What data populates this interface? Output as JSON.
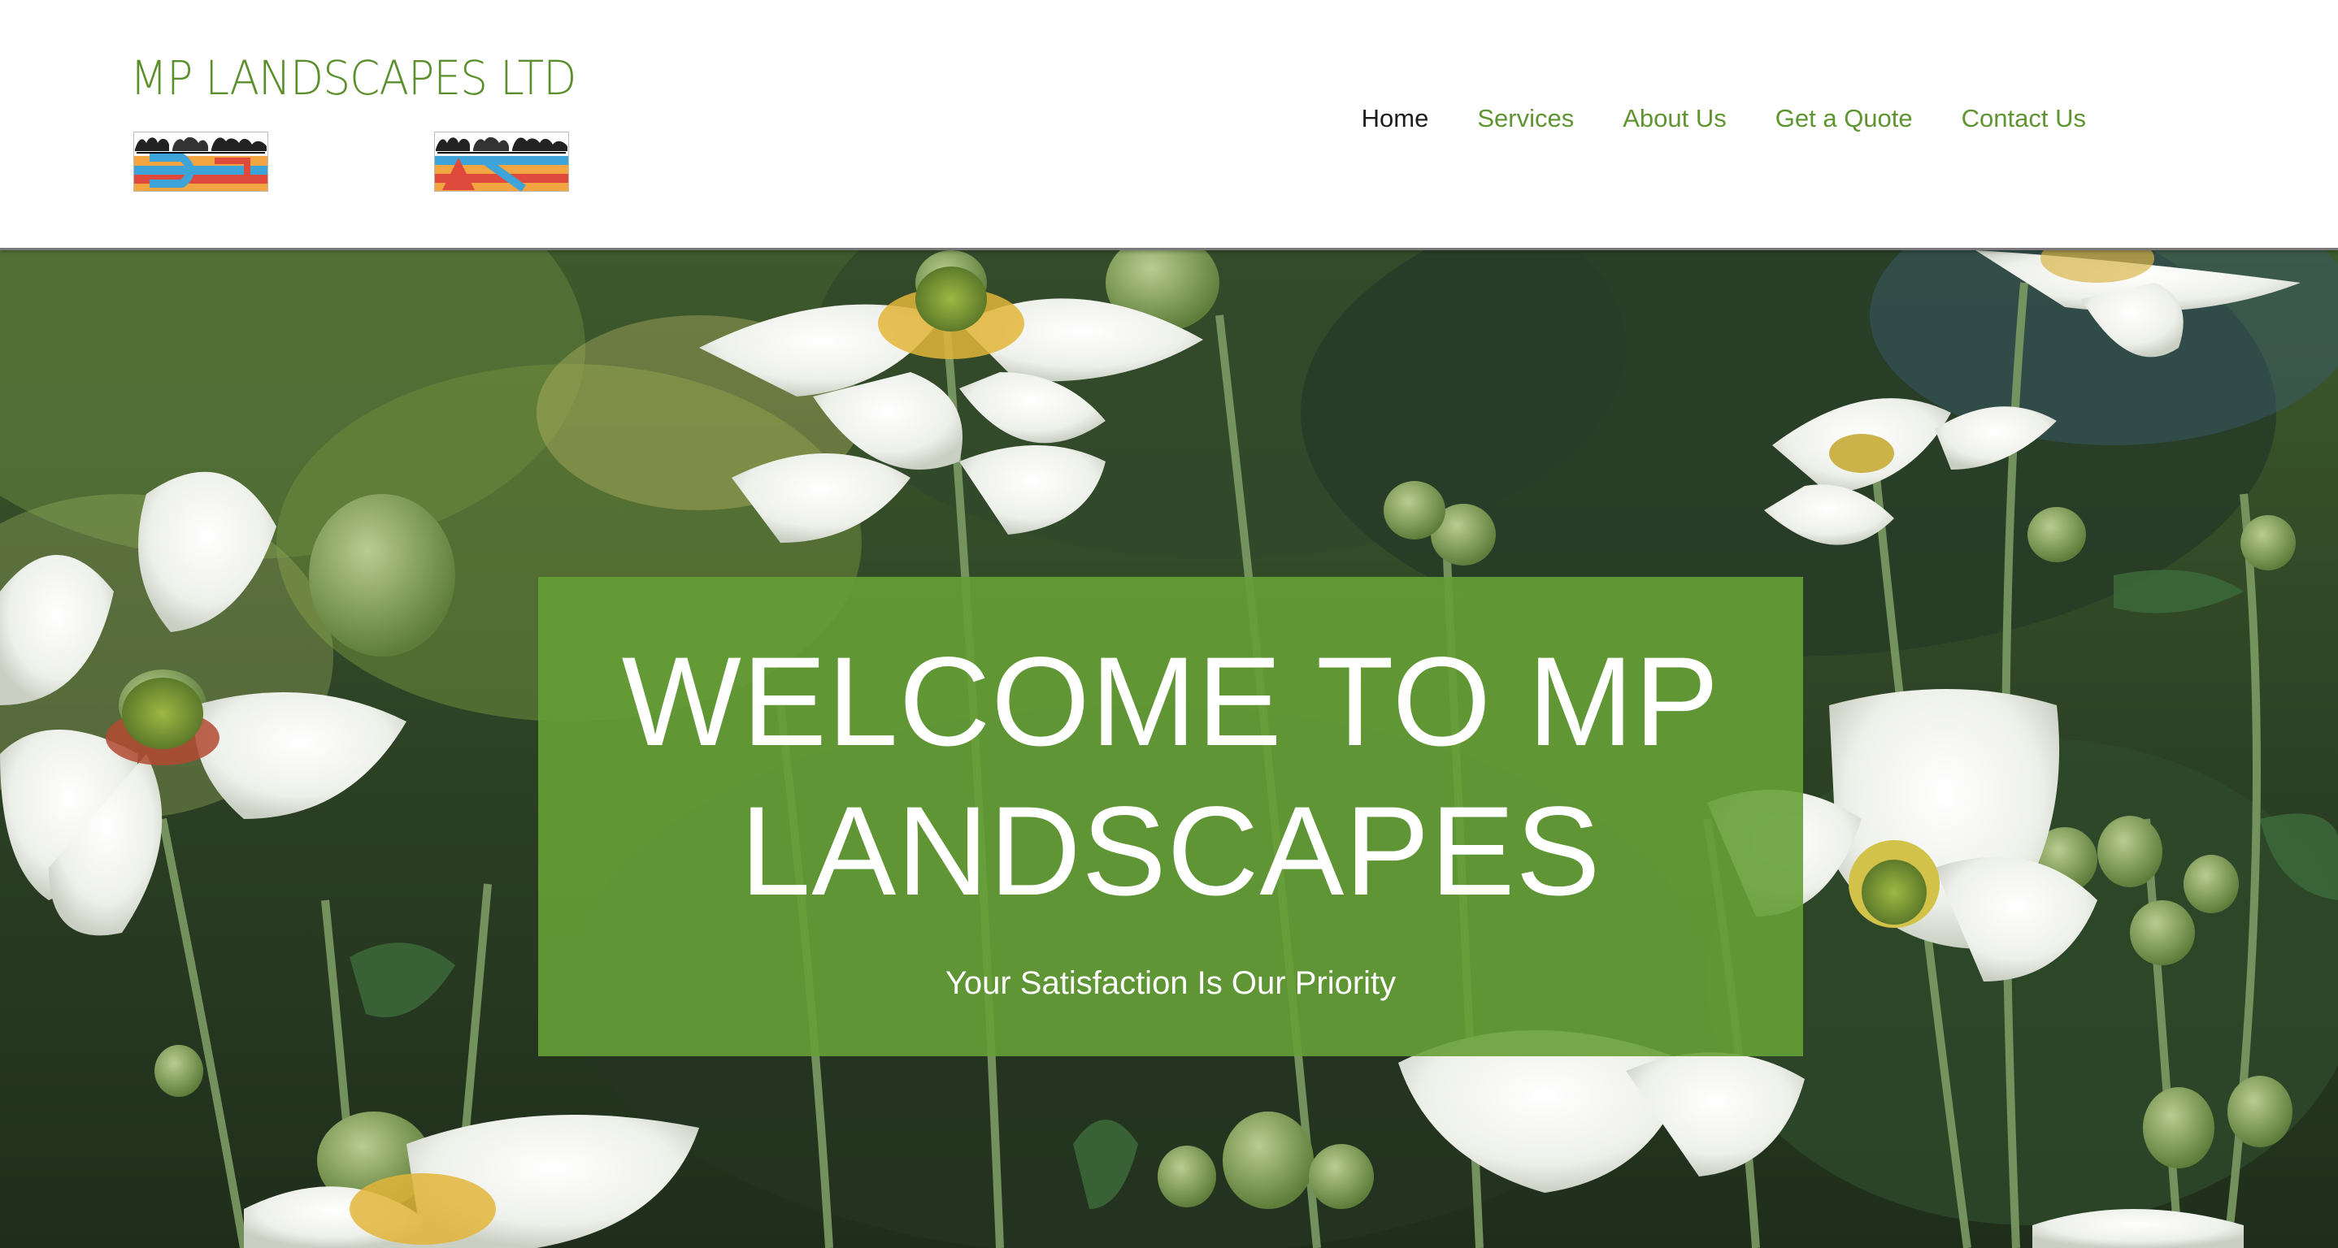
{
  "header": {
    "brand": "MP LANDSCAPES LTD",
    "logos": [
      {
        "icon": "landscape-logo-icon"
      },
      {
        "icon": "landscape-logo-icon"
      }
    ]
  },
  "nav": {
    "items": [
      {
        "label": "Home",
        "active": true
      },
      {
        "label": "Services",
        "active": false
      },
      {
        "label": "About Us",
        "active": false
      },
      {
        "label": "Get a Quote",
        "active": false
      },
      {
        "label": "Contact Us",
        "active": false
      }
    ]
  },
  "hero": {
    "title": "WELCOME TO MP LANDSCAPES",
    "subtitle": "Your Satisfaction Is Our Priority",
    "background": "white-anemone-flowers-photo"
  },
  "colors": {
    "brand_green": "#5a8f2c",
    "nav_green": "#5f9530",
    "nav_active": "#1d1d1d",
    "welcome_box": "#66a036"
  }
}
